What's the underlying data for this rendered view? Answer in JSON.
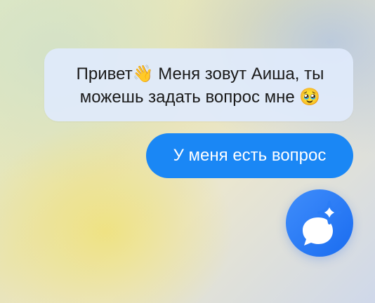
{
  "messages": {
    "incoming": {
      "line1": "Привет👋 Меня зовут Аиша, ты",
      "line2": "можешь задать вопрос мне 🥹"
    },
    "outgoing": {
      "text": "У меня есть вопрос"
    }
  },
  "assistant_button": {
    "icon": "chat-sparkle-icon"
  },
  "colors": {
    "incoming_bubble": "#e0eafc",
    "outgoing_bubble": "#1a87f5",
    "assistant_button": "#2a7cf6"
  }
}
